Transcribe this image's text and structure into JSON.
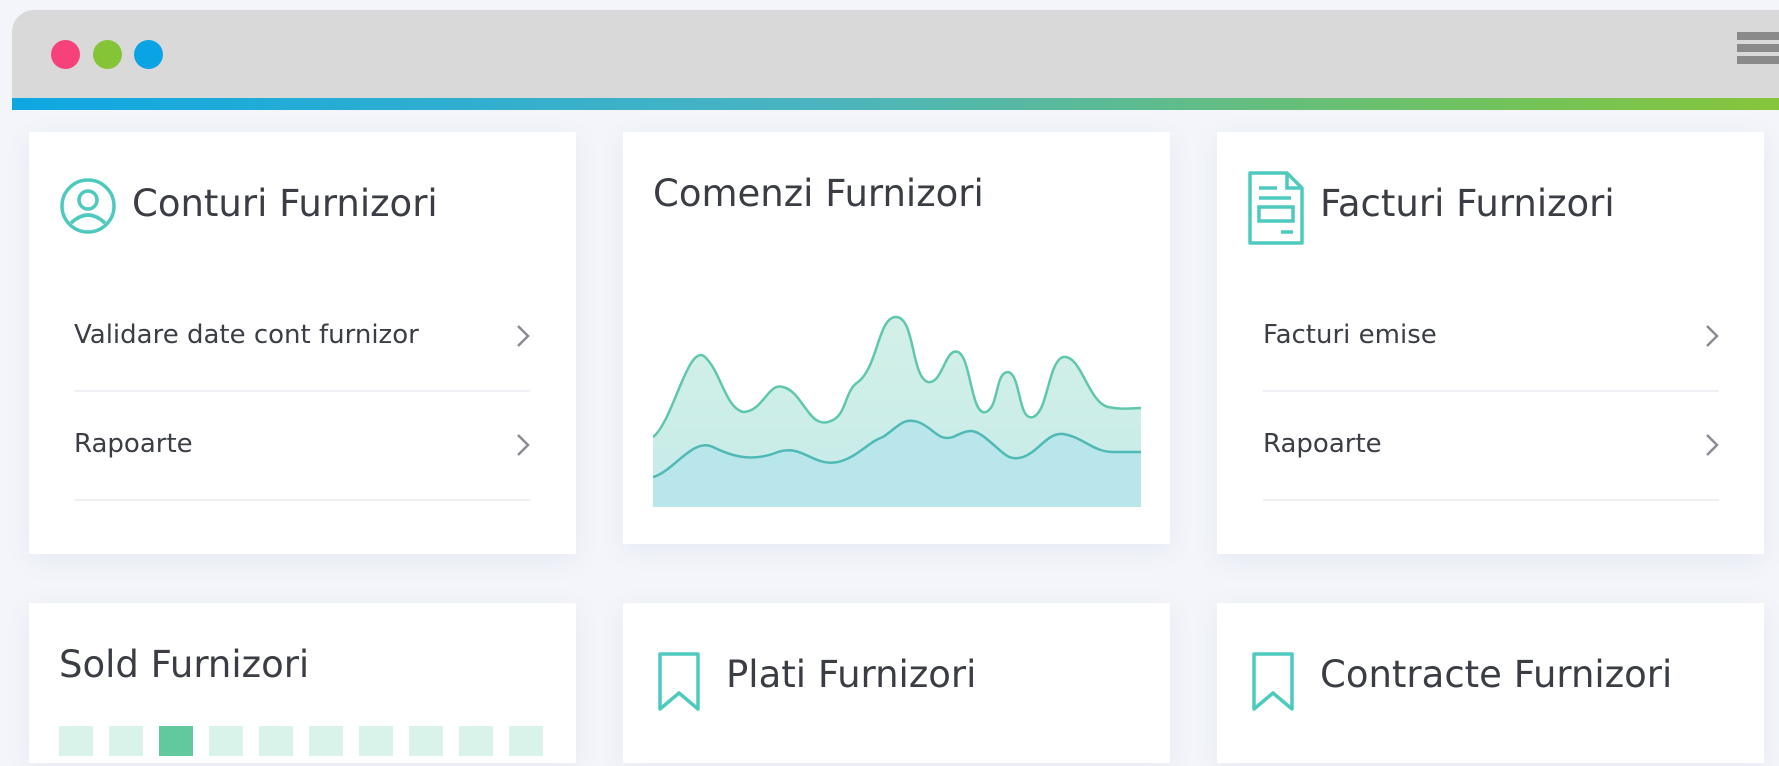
{
  "window": {
    "traffic_lights": {
      "red": "#f7417b",
      "green": "#85c436",
      "blue": "#0aa3e3"
    },
    "menu_icon": "hamburger-menu-icon"
  },
  "accent_colors": {
    "teal": "#4ec9be",
    "chart_line": "#5fc7ad",
    "chart_fill_top": "#cdeee3",
    "chart_fill_bottom": "#bfe6ec"
  },
  "cards": {
    "conturi": {
      "icon": "user-circle-icon",
      "title": "Conturi Furnizori",
      "items": [
        {
          "label": "Validare date cont furnizor"
        },
        {
          "label": "Rapoarte"
        }
      ]
    },
    "comenzi": {
      "title": "Comenzi Furnizori"
    },
    "facturi": {
      "icon": "invoice-document-icon",
      "title": "Facturi Furnizori",
      "items": [
        {
          "label": "Facturi emise"
        },
        {
          "label": "Rapoarte"
        }
      ]
    },
    "sold": {
      "title": "Sold Furnizori"
    },
    "plati": {
      "icon": "bookmark-icon",
      "title": "Plati Furnizori"
    },
    "contracte": {
      "icon": "bookmark-icon",
      "title": "Contracte Furnizori"
    }
  }
}
